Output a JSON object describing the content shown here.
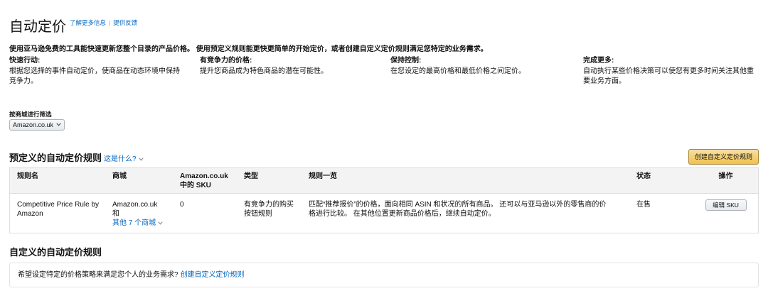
{
  "header": {
    "title": "自动定价",
    "learn_more": "了解更多信息",
    "separator": "|",
    "feedback": "提供反馈"
  },
  "intro": "使用亚马逊免费的工具能快速更新您整个目录的产品价格。 使用预定义规则能更快更简单的开始定价，或者创建自定义定价规则满足您特定的业务需求。",
  "features": [
    {
      "title": "快速行动:",
      "text": "根据您选择的事件自动定价，使商品在动态环境中保持竞争力。"
    },
    {
      "title": "有竞争力的价格:",
      "text": "提升您商品成为特色商品的潜在可能性。"
    },
    {
      "title": "保持控制:",
      "text": "在您设定的最高价格和最低价格之间定价。"
    },
    {
      "title": "完成更多:",
      "text": "自动执行某些价格决策可以使您有更多时间关注其他重要业务方面。"
    }
  ],
  "filter": {
    "label": "按商城进行筛选",
    "selected": "Amazon.co.uk"
  },
  "predefined": {
    "heading": "预定义的自动定价规则",
    "help_link": "这是什么?",
    "create_button": "创建自定义定价规则",
    "columns": [
      "规则名",
      "商城",
      "Amazon.co.uk 中的 SKU",
      "类型",
      "规则一览",
      "状态",
      "操作"
    ],
    "rows": [
      {
        "name": "Competitive Price Rule by Amazon",
        "marketplace": "Amazon.co.uk",
        "marketplace_and": "和",
        "other_marketplaces": "其他 7 个商城",
        "sku_count": "0",
        "type": "有竞争力的购买按钮规则",
        "summary": "匹配“推荐报价”的价格，面向相同 ASIN 和状况的所有商品。 还可以与亚马逊以外的零售商的价格进行比较。 在其他位置更新商品价格后，继续自动定价。",
        "status": "在售",
        "action": "编辑 SKU"
      }
    ]
  },
  "custom": {
    "heading": "自定义的自动定价规则",
    "prompt": "希望设定特定的价格策略来满足您个人的业务需求?",
    "link": "创建自定义定价规则"
  },
  "icons": {
    "help_toggle": "chevron-down-icon",
    "marketplaces_toggle": "chevron-down-icon",
    "select_arrow": "chevron-down-icon"
  },
  "theme": {
    "text": "#111111",
    "link": "#0066c0",
    "border": "#dddddd",
    "table_header_bg": "#f3f3f3",
    "primary_button_top": "#f7dfa5",
    "primary_button_bottom": "#f0c14b",
    "primary_button_border": "#a88734",
    "secondary_button_border": "#adb1b8"
  }
}
